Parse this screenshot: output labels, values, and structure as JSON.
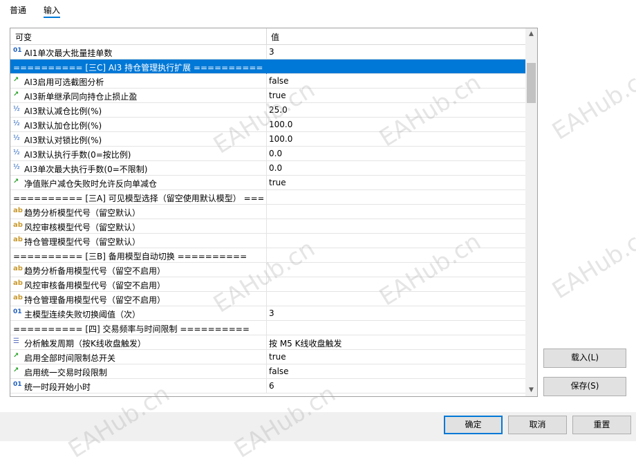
{
  "tabs": [
    {
      "label": "普通",
      "active": false
    },
    {
      "label": "输入",
      "active": true
    }
  ],
  "table": {
    "headers": {
      "name": "可变",
      "value": "值"
    },
    "rows": [
      {
        "icon": "01",
        "type": "int",
        "name": "AI1单次最大批量挂单数",
        "value": "3",
        "selected": false
      },
      {
        "icon": "",
        "type": "none",
        "name": "========== [三C] AI3 持仓管理执行扩展 ==========",
        "value": "",
        "selected": true
      },
      {
        "icon": "↗",
        "type": "bool",
        "name": "AI3启用可选截图分析",
        "value": "false",
        "selected": false
      },
      {
        "icon": "↗",
        "type": "bool",
        "name": "AI3新单继承同向持仓止损止盈",
        "value": "true",
        "selected": false
      },
      {
        "icon": "½",
        "type": "dbl",
        "name": "AI3默认减仓比例(%)",
        "value": "25.0",
        "selected": false
      },
      {
        "icon": "½",
        "type": "dbl",
        "name": "AI3默认加仓比例(%)",
        "value": "100.0",
        "selected": false
      },
      {
        "icon": "½",
        "type": "dbl",
        "name": "AI3默认对锁比例(%)",
        "value": "100.0",
        "selected": false
      },
      {
        "icon": "½",
        "type": "dbl",
        "name": "AI3默认执行手数(0=按比例)",
        "value": "0.0",
        "selected": false
      },
      {
        "icon": "½",
        "type": "dbl",
        "name": "AI3单次最大执行手数(0=不限制)",
        "value": "0.0",
        "selected": false
      },
      {
        "icon": "↗",
        "type": "bool",
        "name": "净值账户减仓失败时允许反向单减仓",
        "value": "true",
        "selected": false
      },
      {
        "icon": "",
        "type": "none",
        "name": "========== [三A] 可见模型选择（留空使用默认模型） ===...",
        "value": "",
        "selected": false
      },
      {
        "icon": "ab",
        "type": "str",
        "name": "趋势分析模型代号（留空默认）",
        "value": "",
        "selected": false
      },
      {
        "icon": "ab",
        "type": "str",
        "name": "风控审核模型代号（留空默认）",
        "value": "",
        "selected": false
      },
      {
        "icon": "ab",
        "type": "str",
        "name": "持仓管理模型代号（留空默认）",
        "value": "",
        "selected": false
      },
      {
        "icon": "",
        "type": "none",
        "name": "========== [三B] 备用模型自动切换 ==========",
        "value": "",
        "selected": false
      },
      {
        "icon": "ab",
        "type": "str",
        "name": "趋势分析备用模型代号（留空不启用）",
        "value": "",
        "selected": false
      },
      {
        "icon": "ab",
        "type": "str",
        "name": "风控审核备用模型代号（留空不启用）",
        "value": "",
        "selected": false
      },
      {
        "icon": "ab",
        "type": "str",
        "name": "持仓管理备用模型代号（留空不启用）",
        "value": "",
        "selected": false
      },
      {
        "icon": "01",
        "type": "int",
        "name": "主模型连续失败切换阈值（次）",
        "value": "3",
        "selected": false
      },
      {
        "icon": "",
        "type": "none",
        "name": "========== [四] 交易频率与时间限制 ==========",
        "value": "",
        "selected": false
      },
      {
        "icon": "☰",
        "type": "enm",
        "name": "分析触发周期（按K线收盘触发）",
        "value": "按 M5 K线收盘触发",
        "selected": false
      },
      {
        "icon": "↗",
        "type": "bool",
        "name": "启用全部时间限制总开关",
        "value": "true",
        "selected": false
      },
      {
        "icon": "↗",
        "type": "bool",
        "name": "启用统一交易时段限制",
        "value": "false",
        "selected": false
      },
      {
        "icon": "01",
        "type": "int",
        "name": "统一时段开始小时",
        "value": "6",
        "selected": false
      }
    ]
  },
  "buttons": {
    "load": "载入(L)",
    "save": "保存(S)",
    "ok": "确定",
    "cancel": "取消",
    "reset": "重置"
  },
  "watermark": "EAHub.cn"
}
